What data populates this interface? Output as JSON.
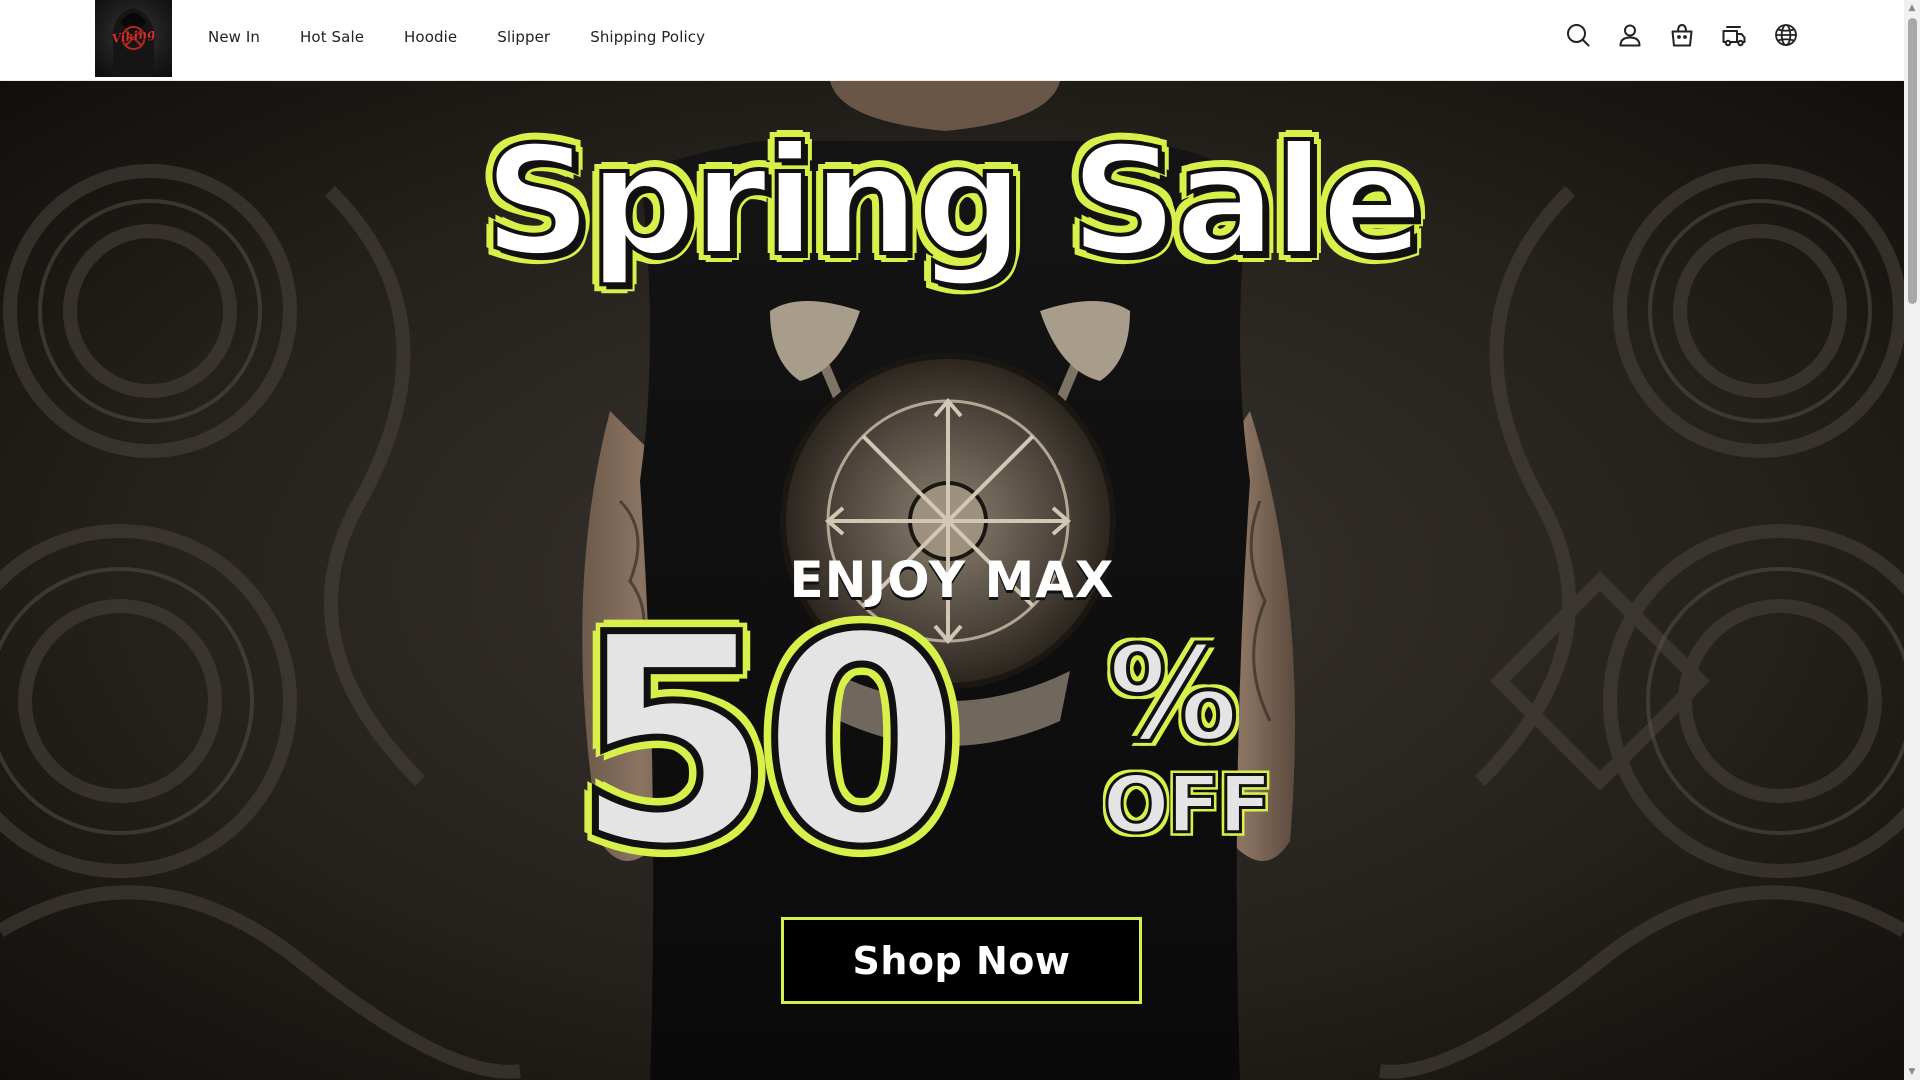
{
  "header": {
    "logo_text": "Viking",
    "nav": [
      {
        "label": "New In"
      },
      {
        "label": "Hot Sale"
      },
      {
        "label": "Hoodie"
      },
      {
        "label": "Slipper"
      },
      {
        "label": "Shipping Policy"
      }
    ],
    "icons": [
      "search-icon",
      "account-icon",
      "cart-icon",
      "order-tracking-icon",
      "language-icon"
    ]
  },
  "hero": {
    "headline": "Spring Sale",
    "subheadline": "ENJOY MAX",
    "discount_number": "50",
    "discount_symbol": "%",
    "discount_suffix": "OFF",
    "cta_label": "Shop Now"
  },
  "colors": {
    "accent": "#d9f04a",
    "hero_background": "#1c1915",
    "button_background": "#000000",
    "header_background": "#ffffff"
  }
}
